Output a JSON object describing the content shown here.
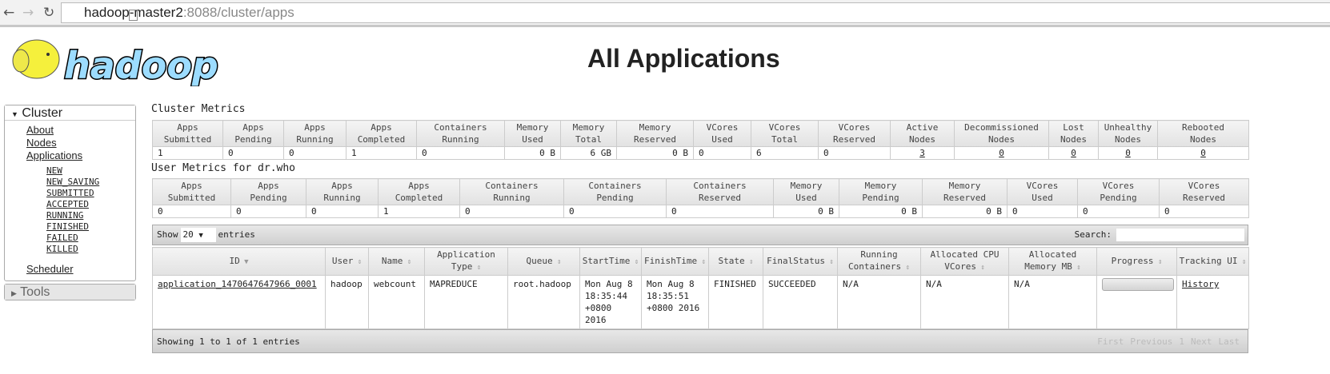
{
  "browser": {
    "url_host": "hadoop-master2",
    "url_path": ":8088/cluster/apps"
  },
  "logo_text": "hadoop",
  "title": "All Applications",
  "sidebar": {
    "cluster": "Cluster",
    "items": [
      "About",
      "Nodes",
      "Applications"
    ],
    "states": [
      "NEW",
      "NEW_SAVING",
      "SUBMITTED",
      "ACCEPTED",
      "RUNNING",
      "FINISHED",
      "FAILED",
      "KILLED"
    ],
    "scheduler": "Scheduler",
    "tools": "Tools"
  },
  "cluster_metrics": {
    "caption": "Cluster Metrics",
    "headers": [
      [
        "Apps",
        "Submitted"
      ],
      [
        "Apps",
        "Pending"
      ],
      [
        "Apps",
        "Running"
      ],
      [
        "Apps",
        "Completed"
      ],
      [
        "Containers",
        "Running"
      ],
      [
        "Memory",
        "Used"
      ],
      [
        "Memory",
        "Total"
      ],
      [
        "Memory",
        "Reserved"
      ],
      [
        "VCores",
        "Used"
      ],
      [
        "VCores",
        "Total"
      ],
      [
        "VCores",
        "Reserved"
      ],
      [
        "Active",
        "Nodes"
      ],
      [
        "Decommissioned",
        "Nodes"
      ],
      [
        "Lost",
        "Nodes"
      ],
      [
        "Unhealthy",
        "Nodes"
      ],
      [
        "Rebooted",
        "Nodes"
      ]
    ],
    "values": [
      "1",
      "0",
      "0",
      "1",
      "0",
      "0 B",
      "6 GB",
      "0 B",
      "0",
      "6",
      "0",
      "3",
      "0",
      "0",
      "0",
      "0"
    ]
  },
  "user_metrics": {
    "caption": "User Metrics for dr.who",
    "headers": [
      [
        "Apps",
        "Submitted"
      ],
      [
        "Apps",
        "Pending"
      ],
      [
        "Apps",
        "Running"
      ],
      [
        "Apps",
        "Completed"
      ],
      [
        "Containers",
        "Running"
      ],
      [
        "Containers",
        "Pending"
      ],
      [
        "Containers",
        "Reserved"
      ],
      [
        "Memory",
        "Used"
      ],
      [
        "Memory",
        "Pending"
      ],
      [
        "Memory",
        "Reserved"
      ],
      [
        "VCores",
        "Used"
      ],
      [
        "VCores",
        "Pending"
      ],
      [
        "VCores",
        "Reserved"
      ]
    ],
    "values": [
      "0",
      "0",
      "0",
      "1",
      "0",
      "0",
      "0",
      "0 B",
      "0 B",
      "0 B",
      "0",
      "0",
      "0"
    ]
  },
  "apps": {
    "show": "Show",
    "page_size": "20",
    "entries": "entries",
    "search_label": "Search:",
    "headers": [
      "ID",
      "User",
      "Name",
      "Application Type",
      "Queue",
      "StartTime",
      "FinishTime",
      "State",
      "FinalStatus",
      "Running Containers",
      "Allocated CPU VCores",
      "Allocated Memory MB",
      "Progress",
      "Tracking UI"
    ],
    "rows": [
      {
        "id": "application_1470647647966_0001",
        "user": "hadoop",
        "name": "webcount",
        "type": "MAPREDUCE",
        "queue": "root.hadoop",
        "start": "Mon Aug 8 18:35:44 +0800 2016",
        "finish": "Mon Aug 8 18:35:51 +0800 2016",
        "state": "FINISHED",
        "final": "SUCCEEDED",
        "containers": "N/A",
        "cpu": "N/A",
        "mem": "N/A",
        "progress": 0,
        "tracking": "History"
      }
    ],
    "info": "Showing 1 to 1 of 1 entries",
    "pager": [
      "First",
      "Previous",
      "1",
      "Next",
      "Last"
    ]
  }
}
